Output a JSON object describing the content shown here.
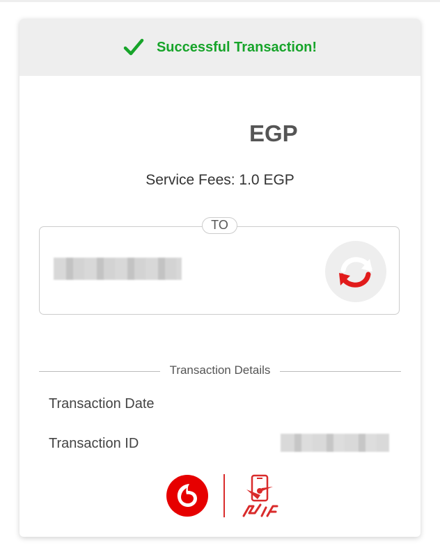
{
  "header": {
    "title": "Successful Transaction!",
    "icon": "check-icon",
    "accent_color": "#17a42a"
  },
  "amount": {
    "currency": "EGP"
  },
  "fees": {
    "text": "Service Fees: 1.0 EGP"
  },
  "recipient": {
    "to_label": "TO",
    "refresh_icon": "refresh-icon"
  },
  "details": {
    "title": "Transaction Details",
    "date_label": "Transaction Date",
    "id_label": "Transaction ID"
  },
  "footer": {
    "brand_logo": "vodafone-logo",
    "wallet_logo": "vodafone-cash-logo",
    "brand_color": "#e60000"
  }
}
